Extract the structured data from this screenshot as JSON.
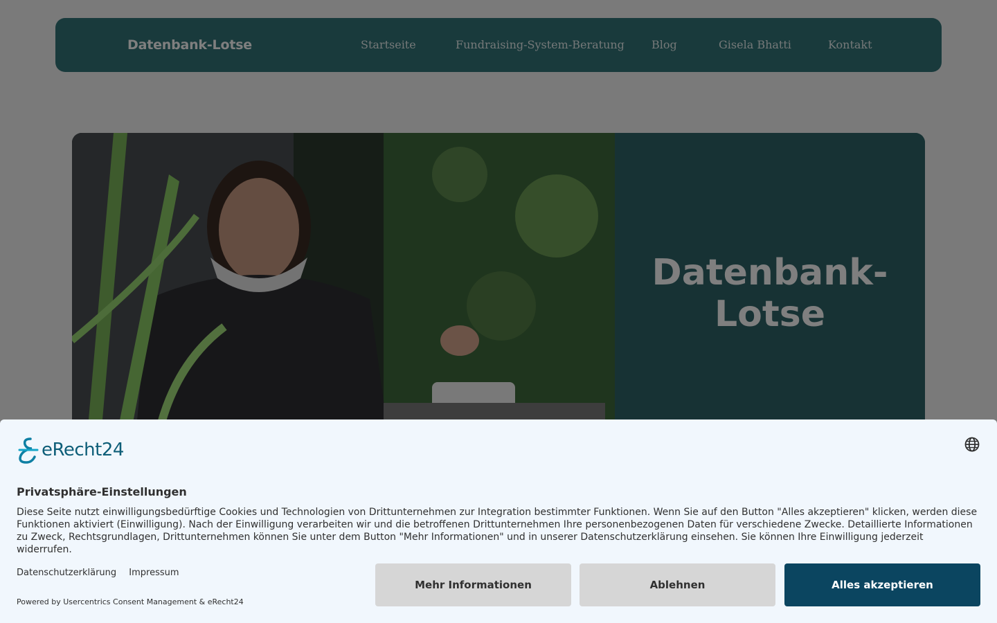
{
  "header": {
    "brand": "Datenbank-Lotse",
    "nav": [
      {
        "label": "Startseite"
      },
      {
        "label": "Fundraising-System-Beratung"
      },
      {
        "label": "Blog"
      },
      {
        "label": "Gisela Bhatti"
      },
      {
        "label": "Kontakt"
      }
    ]
  },
  "hero": {
    "title_line1": "Datenbank-",
    "title_line2": "Lotse"
  },
  "consent": {
    "logo_text": "eRecht24",
    "title": "Privatsphäre-Einstellungen",
    "text": "Diese Seite nutzt einwilligungsbedürftige Cookies und Technologien von Drittunternehmen zur Integration bestimmter Funktionen. Wenn Sie auf den Button \"Alles akzeptieren\" klicken, werden diese Funktionen aktiviert (Einwilligung). Nach der Einwilligung verarbeiten wir und die betroffenen Drittunternehmen Ihre personenbezogenen Daten für verschiedene Zwecke. Detaillierte Informationen zu Zweck, Rechtsgrundlagen, Drittunternehmen können Sie unter dem Button \"Mehr Informationen\" und in unserer Datenschutzerklärung einsehen. Sie können Ihre Einwilligung jederzeit widerrufen.",
    "link_privacy": "Datenschutzerklärung",
    "link_imprint": "Impressum",
    "powered": "Powered by Usercentrics Consent Management & eRecht24",
    "btn_more": "Mehr Informationen",
    "btn_deny": "Ablehnen",
    "btn_accept": "Alles akzeptieren",
    "accent_color": "#0b4560"
  }
}
